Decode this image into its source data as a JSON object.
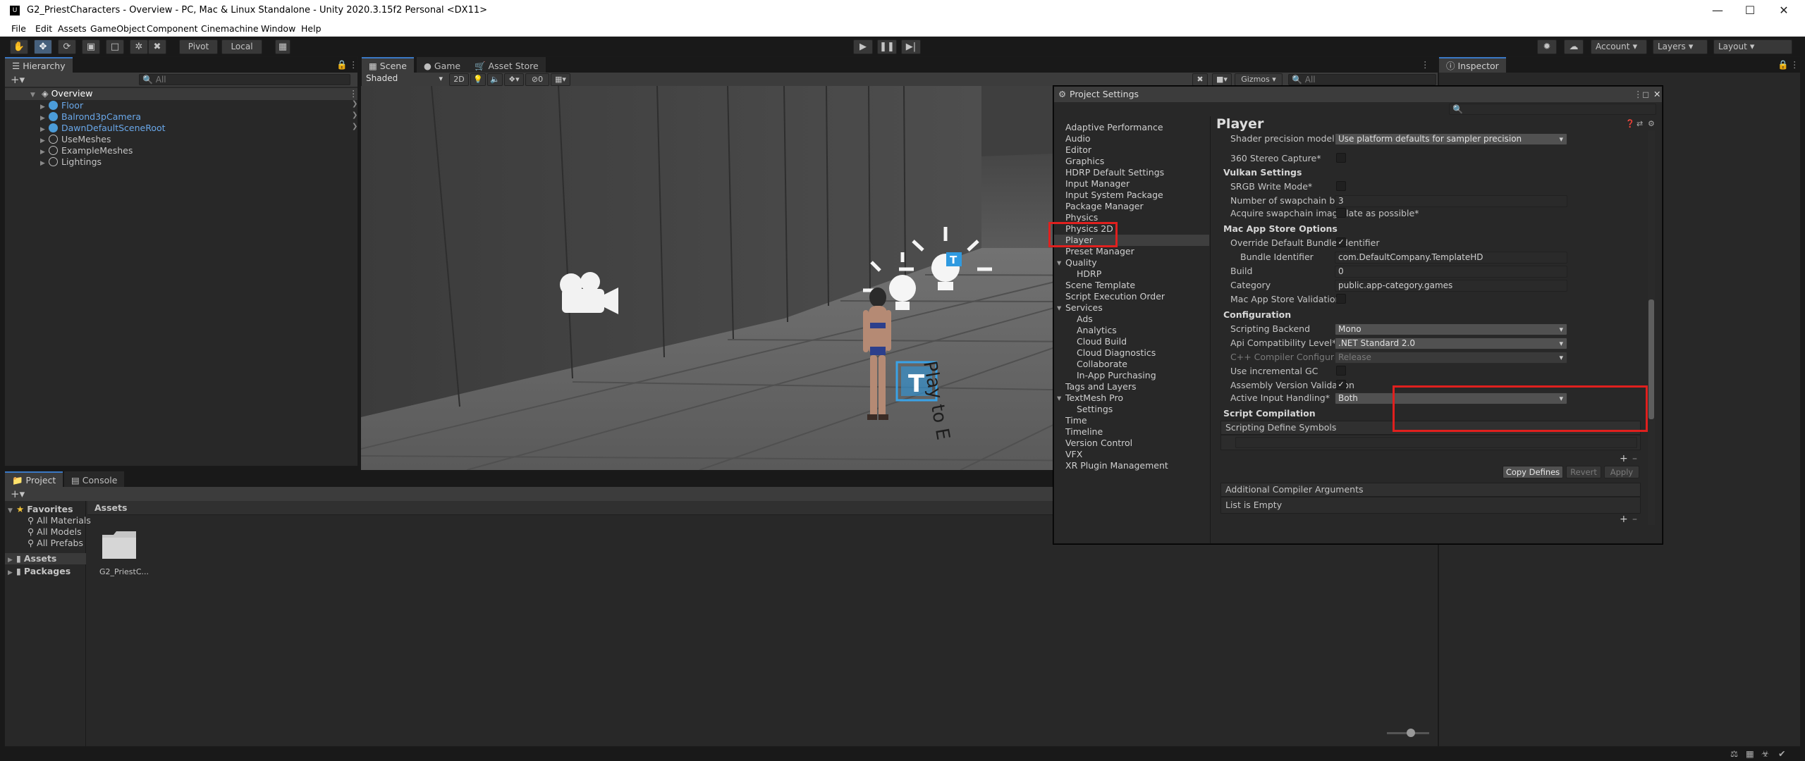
{
  "window": {
    "title": "G2_PriestCharacters - Overview - PC, Mac & Linux Standalone - Unity 2020.3.15f2 Personal <DX11>",
    "logo": "U"
  },
  "menu": [
    "File",
    "Edit",
    "Assets",
    "GameObject",
    "Component",
    "Cinemachine",
    "Window",
    "Help"
  ],
  "toolbar": {
    "pivot": "Pivot",
    "local": "Local",
    "account": "Account",
    "layers": "Layers",
    "layout": "Layout"
  },
  "hierarchy": {
    "tab": "Hierarchy",
    "search_placeholder": "All",
    "scene": "Overview",
    "items": [
      "Floor",
      "Balrond3pCamera",
      "DawnDefaultSceneRoot",
      "UseMeshes",
      "ExampleMeshes",
      "Lightings"
    ]
  },
  "scene_tabs": {
    "scene": "Scene",
    "game": "Game",
    "asset_store": "Asset Store"
  },
  "scene_toolbar": {
    "shading": "Shaded",
    "mode_2d": "2D",
    "hidden_count": "0",
    "gizmos": "Gizmos",
    "search_placeholder": "All"
  },
  "scene_overlay": {
    "label_text": "Play to E"
  },
  "project": {
    "tab": "Project",
    "console_tab": "Console",
    "favorites": "Favorites",
    "fav_items": [
      "All Materials",
      "All Models",
      "All Prefabs"
    ],
    "assets": "Assets",
    "packages": "Packages",
    "breadcrumb": "Assets",
    "folder": "G2_PriestC..."
  },
  "inspector": {
    "tab": "Inspector"
  },
  "project_settings": {
    "title": "Project Settings",
    "nav": [
      {
        "label": "Adaptive Performance",
        "indent": 0
      },
      {
        "label": "Audio",
        "indent": 0
      },
      {
        "label": "Editor",
        "indent": 0
      },
      {
        "label": "Graphics",
        "indent": 0
      },
      {
        "label": "HDRP Default Settings",
        "indent": 0
      },
      {
        "label": "Input Manager",
        "indent": 0
      },
      {
        "label": "Input System Package",
        "indent": 0
      },
      {
        "label": "Package Manager",
        "indent": 0
      },
      {
        "label": "Physics",
        "indent": 0
      },
      {
        "label": "Physics 2D",
        "indent": 0
      },
      {
        "label": "Player",
        "indent": 0,
        "selected": true
      },
      {
        "label": "Preset Manager",
        "indent": 0
      },
      {
        "label": "Quality",
        "indent": 0,
        "expanded": true
      },
      {
        "label": "HDRP",
        "indent": 1
      },
      {
        "label": "Scene Template",
        "indent": 0
      },
      {
        "label": "Script Execution Order",
        "indent": 0
      },
      {
        "label": "Services",
        "indent": 0,
        "expanded": true
      },
      {
        "label": "Ads",
        "indent": 1
      },
      {
        "label": "Analytics",
        "indent": 1
      },
      {
        "label": "Cloud Build",
        "indent": 1
      },
      {
        "label": "Cloud Diagnostics",
        "indent": 1
      },
      {
        "label": "Collaborate",
        "indent": 1
      },
      {
        "label": "In-App Purchasing",
        "indent": 1
      },
      {
        "label": "Tags and Layers",
        "indent": 0
      },
      {
        "label": "TextMesh Pro",
        "indent": 0,
        "expanded": true
      },
      {
        "label": "Settings",
        "indent": 1
      },
      {
        "label": "Time",
        "indent": 0
      },
      {
        "label": "Timeline",
        "indent": 0
      },
      {
        "label": "Version Control",
        "indent": 0
      },
      {
        "label": "VFX",
        "indent": 0
      },
      {
        "label": "XR Plugin Management",
        "indent": 0
      }
    ],
    "page_title": "Player",
    "shader_precision_label": "Shader precision model*",
    "shader_precision_value": "Use platform defaults for sampler precision",
    "stereo_label": "360 Stereo Capture*",
    "vulkan_header": "Vulkan Settings",
    "srgb_label": "SRGB Write Mode*",
    "swapchain_label": "Number of swapchain buffers*",
    "swapchain_value": "3",
    "acquire_label": "Acquire swapchain image late as possible*",
    "mac_header": "Mac App Store Options",
    "override_bundle_label": "Override Default Bundle Identifier",
    "bundle_id_label": "Bundle Identifier",
    "bundle_id_value": "com.DefaultCompany.TemplateHD",
    "build_label": "Build",
    "build_value": "0",
    "category_label": "Category",
    "category_value": "public.app-category.games",
    "mac_validation_label": "Mac App Store Validation",
    "config_header": "Configuration",
    "scripting_backend_label": "Scripting Backend",
    "scripting_backend_value": "Mono",
    "api_label": "Api Compatibility Level*",
    "api_value": ".NET Standard 2.0",
    "cpp_label": "C++ Compiler Configuration",
    "cpp_value": "Release",
    "incremental_gc_label": "Use incremental GC",
    "assembly_validation_label": "Assembly Version Validation",
    "active_input_label": "Active Input Handling*",
    "active_input_value": "Both",
    "script_compilation_header": "Script Compilation",
    "define_symbols_label": "Scripting Define Symbols",
    "copy_defines": "Copy Defines",
    "revert": "Revert",
    "apply": "Apply",
    "compiler_args_label": "Additional Compiler Arguments",
    "list_empty": "List is Empty"
  },
  "colors": {
    "accent": "#3a78c5",
    "highlight": "#e0201e",
    "selection": "#46607c",
    "blue_object": "#6aa8ea"
  }
}
